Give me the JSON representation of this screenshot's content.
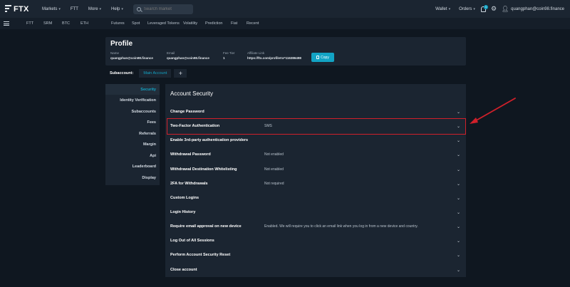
{
  "app": {
    "logo_text": "FTX",
    "accent_color": "#12a3c4",
    "highlight_color": "#d0202a"
  },
  "topnav": {
    "items": [
      {
        "label": "Markets",
        "has_dropdown": true
      },
      {
        "label": "FTT",
        "has_dropdown": false
      },
      {
        "label": "More",
        "has_dropdown": true
      },
      {
        "label": "Help",
        "has_dropdown": true
      }
    ],
    "search_placeholder": "Search market",
    "right": {
      "wallet": "Wallet",
      "orders": "Orders",
      "notification_count": "1",
      "user_email": "quangphan@coin98.finance"
    }
  },
  "subnav": {
    "items": [
      "FTT",
      "SRM",
      "BTC",
      "ETH",
      "Futures",
      "Spot",
      "Leveraged Tokens",
      "Volatility",
      "Prediction",
      "Fiat",
      "Recent"
    ]
  },
  "profile": {
    "title": "Profile",
    "fields": [
      {
        "label": "Name",
        "value": "quangphan@coin98.finance"
      },
      {
        "label": "Email",
        "value": "quangphan@coin98.finance"
      },
      {
        "label": "Fee Tier",
        "value": "1"
      },
      {
        "label": "Affiliate Link",
        "value": "https://ftx.com/profile#a=116386498"
      }
    ],
    "copy_button": "Copy"
  },
  "subaccount": {
    "label": "Subaccount:",
    "active_tab": "Main Account",
    "add_label": "+"
  },
  "side_menu": {
    "items": [
      "Security",
      "Identity Verification",
      "Subaccounts",
      "Fees",
      "Referrals",
      "Margin",
      "Api",
      "Leaderboard",
      "Display"
    ],
    "active_index": 0
  },
  "security": {
    "title": "Account Security",
    "rows": [
      {
        "label": "Change Password",
        "value": ""
      },
      {
        "label": "Two-Factor Authentication",
        "value": "SMS"
      },
      {
        "label": "Enable 3rd-party authentication providers",
        "value": ""
      },
      {
        "label": "Withdrawal Password",
        "value": "Not enabled"
      },
      {
        "label": "Withdrawal Destination Whitelisting",
        "value": "Not enabled"
      },
      {
        "label": "2FA for Withdrawals",
        "value": "Not required"
      },
      {
        "label": "Custom Logins",
        "value": ""
      },
      {
        "label": "Login History",
        "value": ""
      },
      {
        "label": "Require email approval on new device",
        "value": "Enabled. We will require you to click an email link when you log in from a new device and country."
      },
      {
        "label": "Log Out of All Sessions",
        "value": ""
      },
      {
        "label": "Perform Account Security Reset",
        "value": ""
      },
      {
        "label": "Close account",
        "value": ""
      }
    ],
    "highlighted_index": 1
  }
}
